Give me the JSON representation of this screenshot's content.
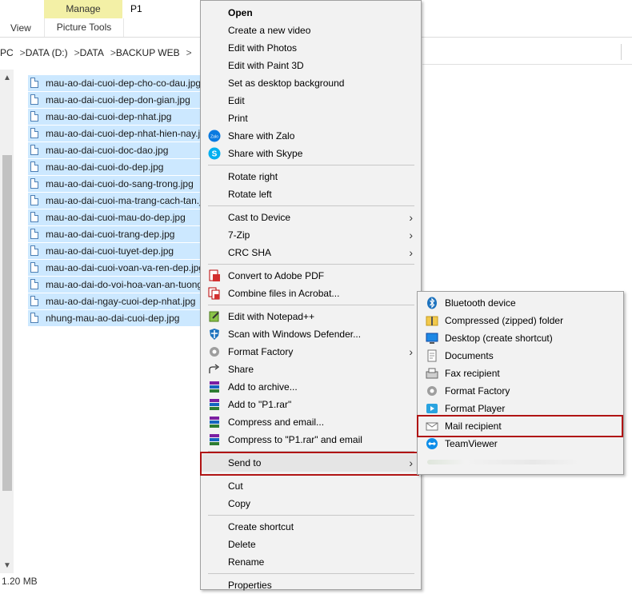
{
  "ribbon": {
    "manage": "Manage",
    "picture_tools": "Picture Tools",
    "p1_tab": "P1",
    "view_tab": "View"
  },
  "address": {
    "crumbs": [
      "PC",
      "DATA (D:)",
      "DATA",
      "BACKUP WEB"
    ],
    "separator": ">"
  },
  "status": {
    "size": "1.20 MB"
  },
  "files": [
    "mau-ao-dai-cuoi-dep-cho-co-dau.jpg",
    "mau-ao-dai-cuoi-dep-don-gian.jpg",
    "mau-ao-dai-cuoi-dep-nhat.jpg",
    "mau-ao-dai-cuoi-dep-nhat-hien-nay.jpg",
    "mau-ao-dai-cuoi-doc-dao.jpg",
    "mau-ao-dai-cuoi-do-dep.jpg",
    "mau-ao-dai-cuoi-do-sang-trong.jpg",
    "mau-ao-dai-cuoi-ma-trang-cach-tan.jpg",
    "mau-ao-dai-cuoi-mau-do-dep.jpg",
    "mau-ao-dai-cuoi-trang-dep.jpg",
    "mau-ao-dai-cuoi-tuyet-dep.jpg",
    "mau-ao-dai-cuoi-voan-va-ren-dep.jpg",
    "mau-ao-dai-do-voi-hoa-van-an-tuong.jpg",
    "mau-ao-dai-ngay-cuoi-dep-nhat.jpg",
    "nhung-mau-ao-dai-cuoi-dep.jpg"
  ],
  "menu": {
    "open": "Open",
    "create_video": "Create a new video",
    "edit_photos": "Edit with Photos",
    "edit_paint3d": "Edit with Paint 3D",
    "set_background": "Set as desktop background",
    "edit": "Edit",
    "print": "Print",
    "share_zalo": "Share with Zalo",
    "share_skype": "Share with Skype",
    "rotate_right": "Rotate right",
    "rotate_left": "Rotate left",
    "cast": "Cast to Device",
    "zip7": "7-Zip",
    "crc": "CRC SHA",
    "convert_pdf": "Convert to Adobe PDF",
    "combine_acrobat": "Combine files in Acrobat...",
    "notepad": "Edit with Notepad++",
    "defender": "Scan with Windows Defender...",
    "format_factory": "Format Factory",
    "share": "Share",
    "add_archive": "Add to archive...",
    "add_rar": "Add to \"P1.rar\"",
    "compress_email": "Compress and email...",
    "compress_rar_email": "Compress to \"P1.rar\" and email",
    "send_to": "Send to",
    "cut": "Cut",
    "copy": "Copy",
    "create_shortcut": "Create shortcut",
    "delete": "Delete",
    "rename": "Rename",
    "properties": "Properties"
  },
  "sendto": {
    "bluetooth": "Bluetooth device",
    "compressed": "Compressed (zipped) folder",
    "desktop": "Desktop (create shortcut)",
    "documents": "Documents",
    "fax": "Fax recipient",
    "format_factory": "Format Factory",
    "format_player": "Format Player",
    "mail": "Mail recipient",
    "teamviewer": "TeamViewer"
  },
  "colors": {
    "selection": "#cce8ff",
    "manage_tab": "#f3f0a6",
    "highlight_border": "#b01414"
  }
}
